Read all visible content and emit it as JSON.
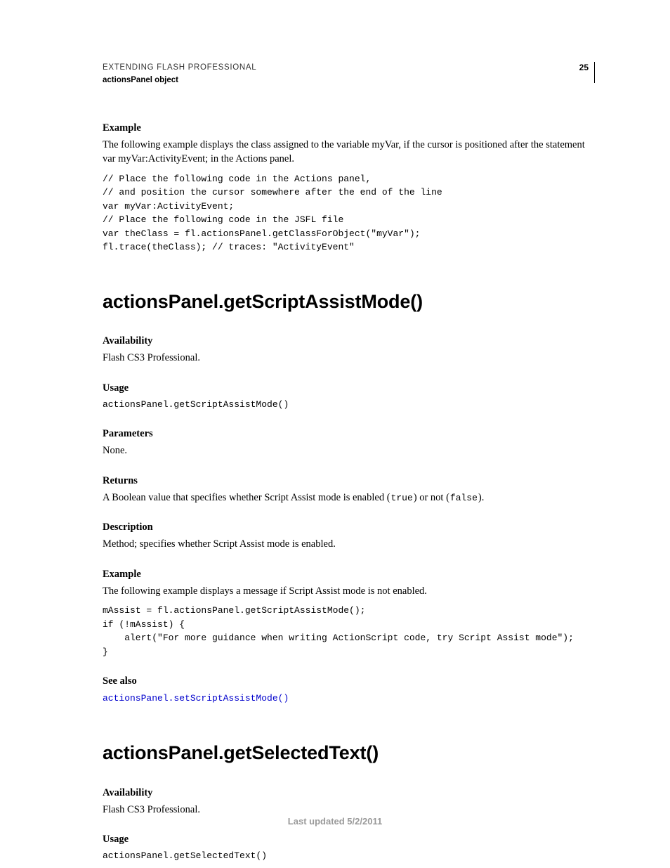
{
  "header": {
    "title": "EXTENDING FLASH PROFESSIONAL",
    "subtitle": "actionsPanel object",
    "page_number": "25"
  },
  "section1": {
    "example_label": "Example",
    "example_text": "The following example displays the class assigned to the variable myVar, if the cursor is positioned after the statement var myVar:ActivityEvent; in the Actions panel.",
    "code": "// Place the following code in the Actions panel,\n// and position the cursor somewhere after the end of the line\nvar myVar:ActivityEvent;\n// Place the following code in the JSFL file\nvar theClass = fl.actionsPanel.getClassForObject(\"myVar\");\nfl.trace(theClass); // traces: \"ActivityEvent\""
  },
  "method1": {
    "heading": "actionsPanel.getScriptAssistMode()",
    "availability_label": "Availability",
    "availability_text": "Flash CS3 Professional.",
    "usage_label": "Usage",
    "usage_code": "actionsPanel.getScriptAssistMode()",
    "parameters_label": "Parameters",
    "parameters_text": "None.",
    "returns_label": "Returns",
    "returns_prefix": "A Boolean value that specifies whether Script Assist mode is enabled (",
    "returns_true": "true",
    "returns_mid": ") or not (",
    "returns_false": "false",
    "returns_suffix": ").",
    "description_label": "Description",
    "description_text": "Method; specifies whether Script Assist mode is enabled.",
    "example_label": "Example",
    "example_text": "The following example displays a message if Script Assist mode is not enabled.",
    "example_code": "mAssist = fl.actionsPanel.getScriptAssistMode();\nif (!mAssist) {\n    alert(\"For more guidance when writing ActionScript code, try Script Assist mode\");\n}",
    "seealso_label": "See also",
    "seealso_link": "actionsPanel.setScriptAssistMode()"
  },
  "method2": {
    "heading": "actionsPanel.getSelectedText()",
    "availability_label": "Availability",
    "availability_text": "Flash CS3 Professional.",
    "usage_label": "Usage",
    "usage_code": "actionsPanel.getSelectedText()"
  },
  "footer": {
    "last_updated": "Last updated 5/2/2011"
  }
}
